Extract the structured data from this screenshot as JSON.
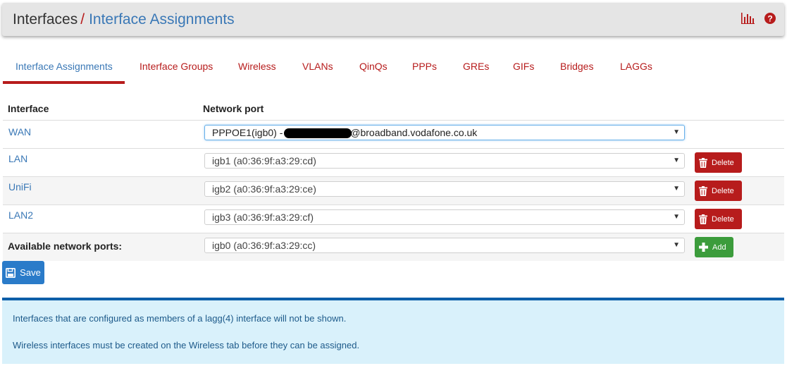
{
  "breadcrumb": {
    "root": "Interfaces",
    "separator": "/",
    "current": "Interface Assignments"
  },
  "header_icons": [
    "bar-chart-icon",
    "help-icon"
  ],
  "tabs": [
    {
      "label": "Interface Assignments",
      "active": true
    },
    {
      "label": "Interface Groups"
    },
    {
      "label": "Wireless"
    },
    {
      "label": "VLANs"
    },
    {
      "label": "QinQs"
    },
    {
      "label": "PPPs"
    },
    {
      "label": "GREs"
    },
    {
      "label": "GIFs"
    },
    {
      "label": "Bridges"
    },
    {
      "label": "LAGGs"
    }
  ],
  "table": {
    "headers": {
      "interface": "Interface",
      "port": "Network port"
    },
    "rows": [
      {
        "name": "WAN",
        "port_prefix": "PPPOE1(igb0) -",
        "port_suffix": "@broadband.vodafone.co.uk",
        "redacted": true,
        "action": null
      },
      {
        "name": "LAN",
        "port": "igb1 (a0:36:9f:a3:29:cd)",
        "action": "Delete"
      },
      {
        "name": "UniFi",
        "port": "igb2 (a0:36:9f:a3:29:ce)",
        "action": "Delete"
      },
      {
        "name": "LAN2",
        "port": "igb3 (a0:36:9f:a3:29:cf)",
        "action": "Delete"
      }
    ],
    "available": {
      "label": "Available network ports:",
      "port": "igb0 (a0:36:9f:a3:29:cc)",
      "action": "Add"
    }
  },
  "save_label": "Save",
  "info": {
    "line1": "Interfaces that are configured as members of a lagg(4) interface will not be shown.",
    "line2": "Wireless interfaces must be created on the Wireless tab before they can be assigned."
  },
  "colors": {
    "accent_red": "#b71c1c",
    "link_blue": "#3a78b6",
    "save_blue": "#2a7bc9",
    "add_green": "#3c9c3c",
    "info_bg": "#d9f1fb"
  }
}
